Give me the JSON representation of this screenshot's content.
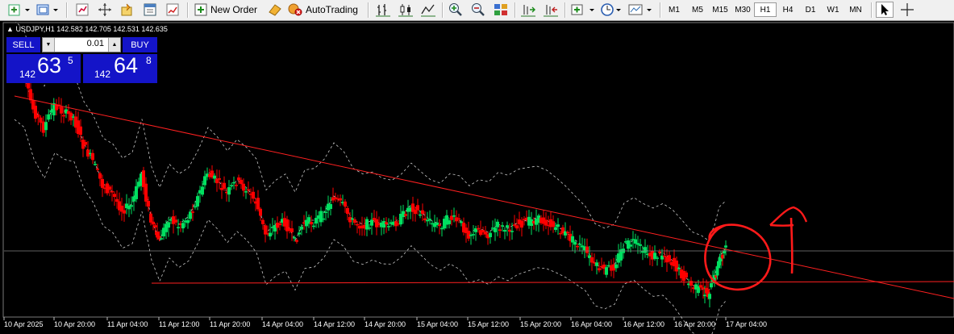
{
  "toolbar": {
    "new_order": "New Order",
    "autotrading": "AutoTrading",
    "timeframes": [
      "M1",
      "M5",
      "M15",
      "M30",
      "H1",
      "H4",
      "D1",
      "W1",
      "MN"
    ],
    "active_timeframe": "H1",
    "icons": [
      "new-chart-icon",
      "profiles-icon",
      "market-watch-icon",
      "navigator-icon",
      "data-window-icon",
      "terminal-icon",
      "strategy-tester-icon",
      "new-order-icon",
      "metaeditor-icon",
      "autotrading-icon",
      "bar-chart-icon",
      "candlesticks-icon",
      "line-chart-icon",
      "zoom-in-icon",
      "zoom-out-icon",
      "tile-windows-icon",
      "chart-shift-icon",
      "autoscroll-icon",
      "indicators-icon",
      "periods-icon",
      "templates-icon",
      "cursor-icon",
      "crosshair-icon"
    ]
  },
  "chart": {
    "symbol_line": "USDJPY,H1  142.582 142.705 142.531 142.635",
    "x_labels": [
      "10 Apr 2025",
      "10 Apr 20:00",
      "11 Apr 04:00",
      "11 Apr 12:00",
      "11 Apr 20:00",
      "14 Apr 04:00",
      "14 Apr 12:00",
      "14 Apr 20:00",
      "15 Apr 04:00",
      "15 Apr 12:00",
      "15 Apr 20:00",
      "16 Apr 04:00",
      "16 Apr 12:00",
      "16 Apr 20:00",
      "17 Apr 04:00"
    ],
    "colors": {
      "bull": "#00e060",
      "bear": "#ff0000",
      "trendline": "#ff2020",
      "bands": "#c8c8c8",
      "annotation": "#ff1a1a"
    }
  },
  "one_click": {
    "sell_label": "SELL",
    "buy_label": "BUY",
    "lot": "0.01",
    "sell_big_figure": "142",
    "sell_pips": "63",
    "sell_point": "5",
    "buy_big_figure": "142",
    "buy_pips": "64",
    "buy_point": "8"
  }
}
